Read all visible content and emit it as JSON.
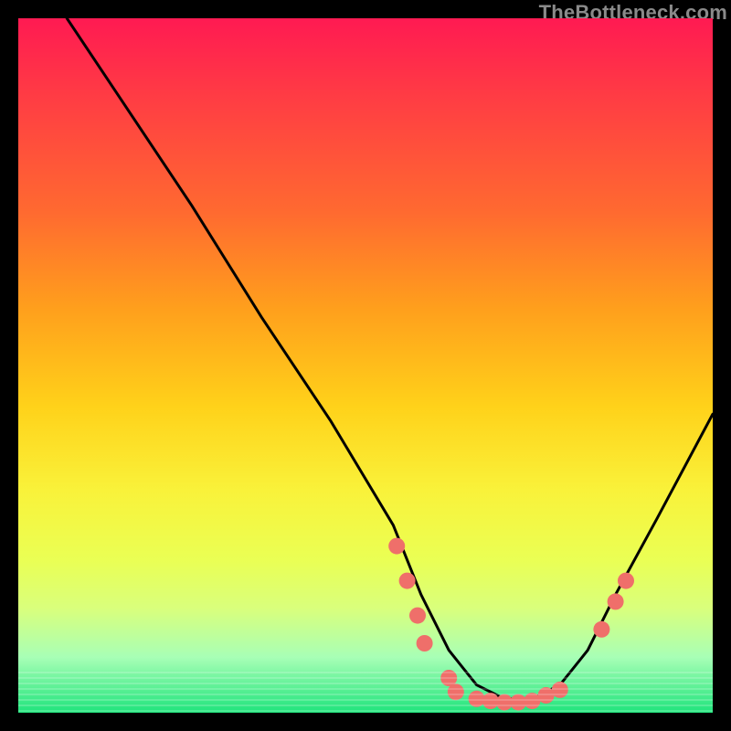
{
  "watermark": "TheBottleneck.com",
  "chart_data": {
    "type": "line",
    "title": "",
    "xlabel": "",
    "ylabel": "",
    "xlim": [
      0,
      100
    ],
    "ylim": [
      0,
      100
    ],
    "series": [
      {
        "name": "curve",
        "x": [
          7,
          15,
          25,
          35,
          45,
          54,
          58,
          62,
          66,
          70,
          74,
          78,
          82,
          86,
          92,
          100
        ],
        "y": [
          100,
          88,
          73,
          57,
          42,
          27,
          17,
          9,
          4,
          2,
          2,
          4,
          9,
          17,
          28,
          43
        ]
      }
    ],
    "markers": [
      {
        "x": 54.5,
        "y": 24
      },
      {
        "x": 56.0,
        "y": 19
      },
      {
        "x": 57.5,
        "y": 14
      },
      {
        "x": 58.5,
        "y": 10
      },
      {
        "x": 62.0,
        "y": 5
      },
      {
        "x": 63.0,
        "y": 3
      },
      {
        "x": 66.0,
        "y": 2
      },
      {
        "x": 68.0,
        "y": 1.7
      },
      {
        "x": 70.0,
        "y": 1.5
      },
      {
        "x": 72.0,
        "y": 1.5
      },
      {
        "x": 74.0,
        "y": 1.7
      },
      {
        "x": 76.0,
        "y": 2.5
      },
      {
        "x": 78.0,
        "y": 3.3
      },
      {
        "x": 84.0,
        "y": 12
      },
      {
        "x": 86.0,
        "y": 16
      },
      {
        "x": 87.5,
        "y": 19
      }
    ],
    "marker_color": "#ef6f6a",
    "line_color": "#000000"
  }
}
